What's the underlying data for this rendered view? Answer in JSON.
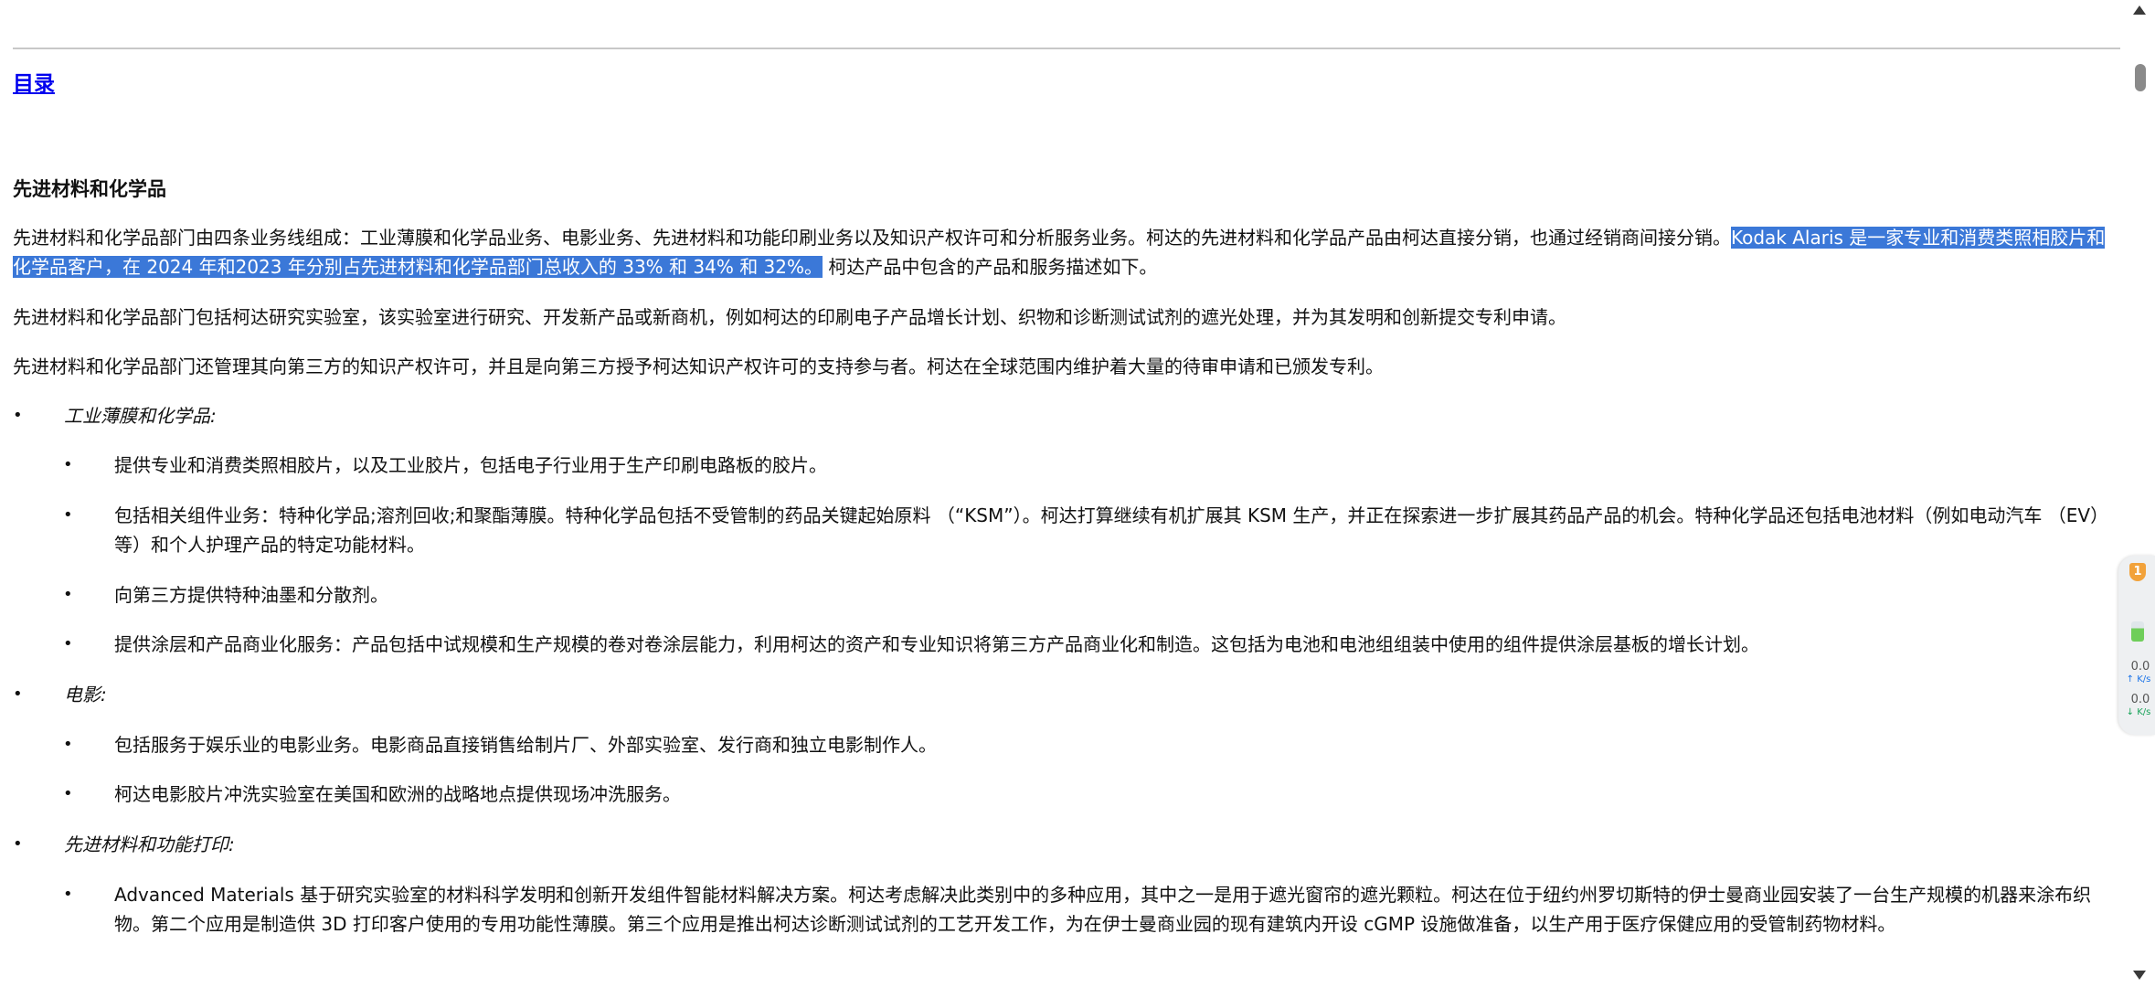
{
  "toc_link": "目录",
  "section_heading": "先进材料和化学品",
  "paragraphs": {
    "p1_line1_pre": "先进材料和化学品部门由四条业务线组成：工业薄膜和化学品业务、电影业务、先进材料和功能印刷业务以及知识产权许可和分析服务业务。柯达的先进材料和化学品产品由柯达直接分销，也通过经销商间接分销。",
    "p1_line1_sel": "Kodak Alaris 是一家专",
    "p1_line2_sel": "业和消费类照相胶片和化学品客户，在 2024 年和2023  年分别占先进材料和化学品部门总收入的 33% 和 34% 和 32%。",
    "p1_line2_post": " 柯达产品中包含的产品和服务描述如下。",
    "p2": "先进材料和化学品部门包括柯达研究实验室，该实验室进行研究、开发新产品或新商机，例如柯达的印刷电子产品增长计划、织物和诊断测试试剂的遮光处理，并为其发明和创新提交专利申请。",
    "p3": "先进材料和化学品部门还管理其向第三方的知识产权许可，并且是向第三方授予柯达知识产权许可的支持参与者。柯达在全球范围内维护着大量的待审申请和已颁发专利。"
  },
  "bullet_char": "•",
  "categories": [
    {
      "title": "工业薄膜和化学品:",
      "items": [
        "提供专业和消费类照相胶片，以及工业胶片，包括电子行业用于生产印刷电路板的胶片。",
        "包括相关组件业务：特种化学品;溶剂回收;和聚酯薄膜。特种化学品包括不受管制的药品关键起始原料 （“KSM”）。柯达打算继续有机扩展其 KSM 生产，并正在探索进一步扩展其药品产品的机会。特种化学品还包括电池材料（例如电动汽车 （EV） 等）和个人护理产品的特定功能材料。",
        "向第三方提供特种油墨和分散剂。",
        "提供涂层和产品商业化服务：产品包括中试规模和生产规模的卷对卷涂层能力，利用柯达的资产和专业知识将第三方产品商业化和制造。这包括为电池和电池组组装中使用的组件提供涂层基板的增长计划。"
      ]
    },
    {
      "title": "电影:",
      "items": [
        "包括服务于娱乐业的电影业务。电影商品直接销售给制片厂、外部实验室、发行商和独立电影制作人。",
        "柯达电影胶片冲洗实验室在美国和欧洲的战略地点提供现场冲洗服务。"
      ]
    },
    {
      "title": "先进材料和功能打印:",
      "items": [
        "Advanced Materials 基于研究实验室的材料科学发明和创新开发组件智能材料解决方案。柯达考虑解决此类别中的多种应用，其中之一是用于遮光窗帘的遮光颗粒。柯达在位于纽约州罗切斯特的伊士曼商业园安装了一台生产规模的机器来涂布织物。第二个应用是制造供 3D 打印客户使用的专用功能性薄膜。第三个应用是推出柯达诊断测试试剂的工艺开发工作，为在伊士曼商业园的现有建筑内开设 cGMP 设施做准备，以生产用于医疗保健应用的受管制药物材料。"
      ]
    }
  ],
  "widget": {
    "badge": "1",
    "upload_value": "0.0",
    "upload_unit": "↑ K/s",
    "download_value": "0.0",
    "download_unit": "↓ K/s"
  },
  "colors": {
    "selection": "#3b78d8",
    "link": "#0000ee"
  }
}
